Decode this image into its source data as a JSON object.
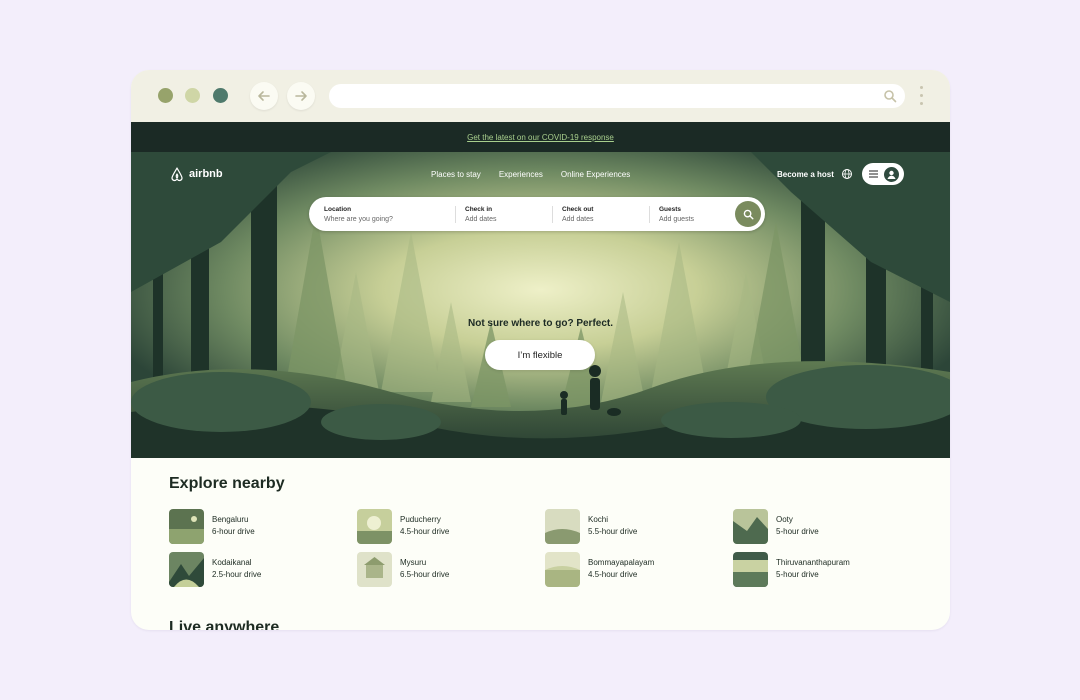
{
  "browser": {
    "url": ""
  },
  "notice": {
    "text": "Get the latest on our COVID-19 response"
  },
  "header": {
    "logo_text": "airbnb",
    "nav": [
      "Places to stay",
      "Experiences",
      "Online Experiences"
    ],
    "become_host": "Become a host"
  },
  "search": {
    "segments": [
      {
        "label": "Location",
        "placeholder": "Where are you going?"
      },
      {
        "label": "Check in",
        "placeholder": "Add dates"
      },
      {
        "label": "Check out",
        "placeholder": "Add dates"
      },
      {
        "label": "Guests",
        "placeholder": "Add guests"
      }
    ]
  },
  "hero": {
    "tagline": "Not sure where to go? Perfect.",
    "cta": "I’m flexible"
  },
  "explore": {
    "title": "Explore nearby",
    "places": [
      {
        "name": "Bengaluru",
        "drive": "6-hour drive"
      },
      {
        "name": "Puducherry",
        "drive": "4.5-hour drive"
      },
      {
        "name": "Kochi",
        "drive": "5.5-hour drive"
      },
      {
        "name": "Ooty",
        "drive": "5-hour drive"
      },
      {
        "name": "Kodaikanal",
        "drive": "2.5-hour drive"
      },
      {
        "name": "Mysuru",
        "drive": "6.5-hour drive"
      },
      {
        "name": "Bommayapalayam",
        "drive": "4.5-hour drive"
      },
      {
        "name": "Thiruvananthapuram",
        "drive": "5-hour drive"
      }
    ]
  },
  "live": {
    "title": "Live anywhere"
  },
  "colors": {
    "page_bg": "#f3eefb",
    "dark_bar": "#1b2a25",
    "accent": "#7a8b5e",
    "link": "#a8cf8d"
  }
}
